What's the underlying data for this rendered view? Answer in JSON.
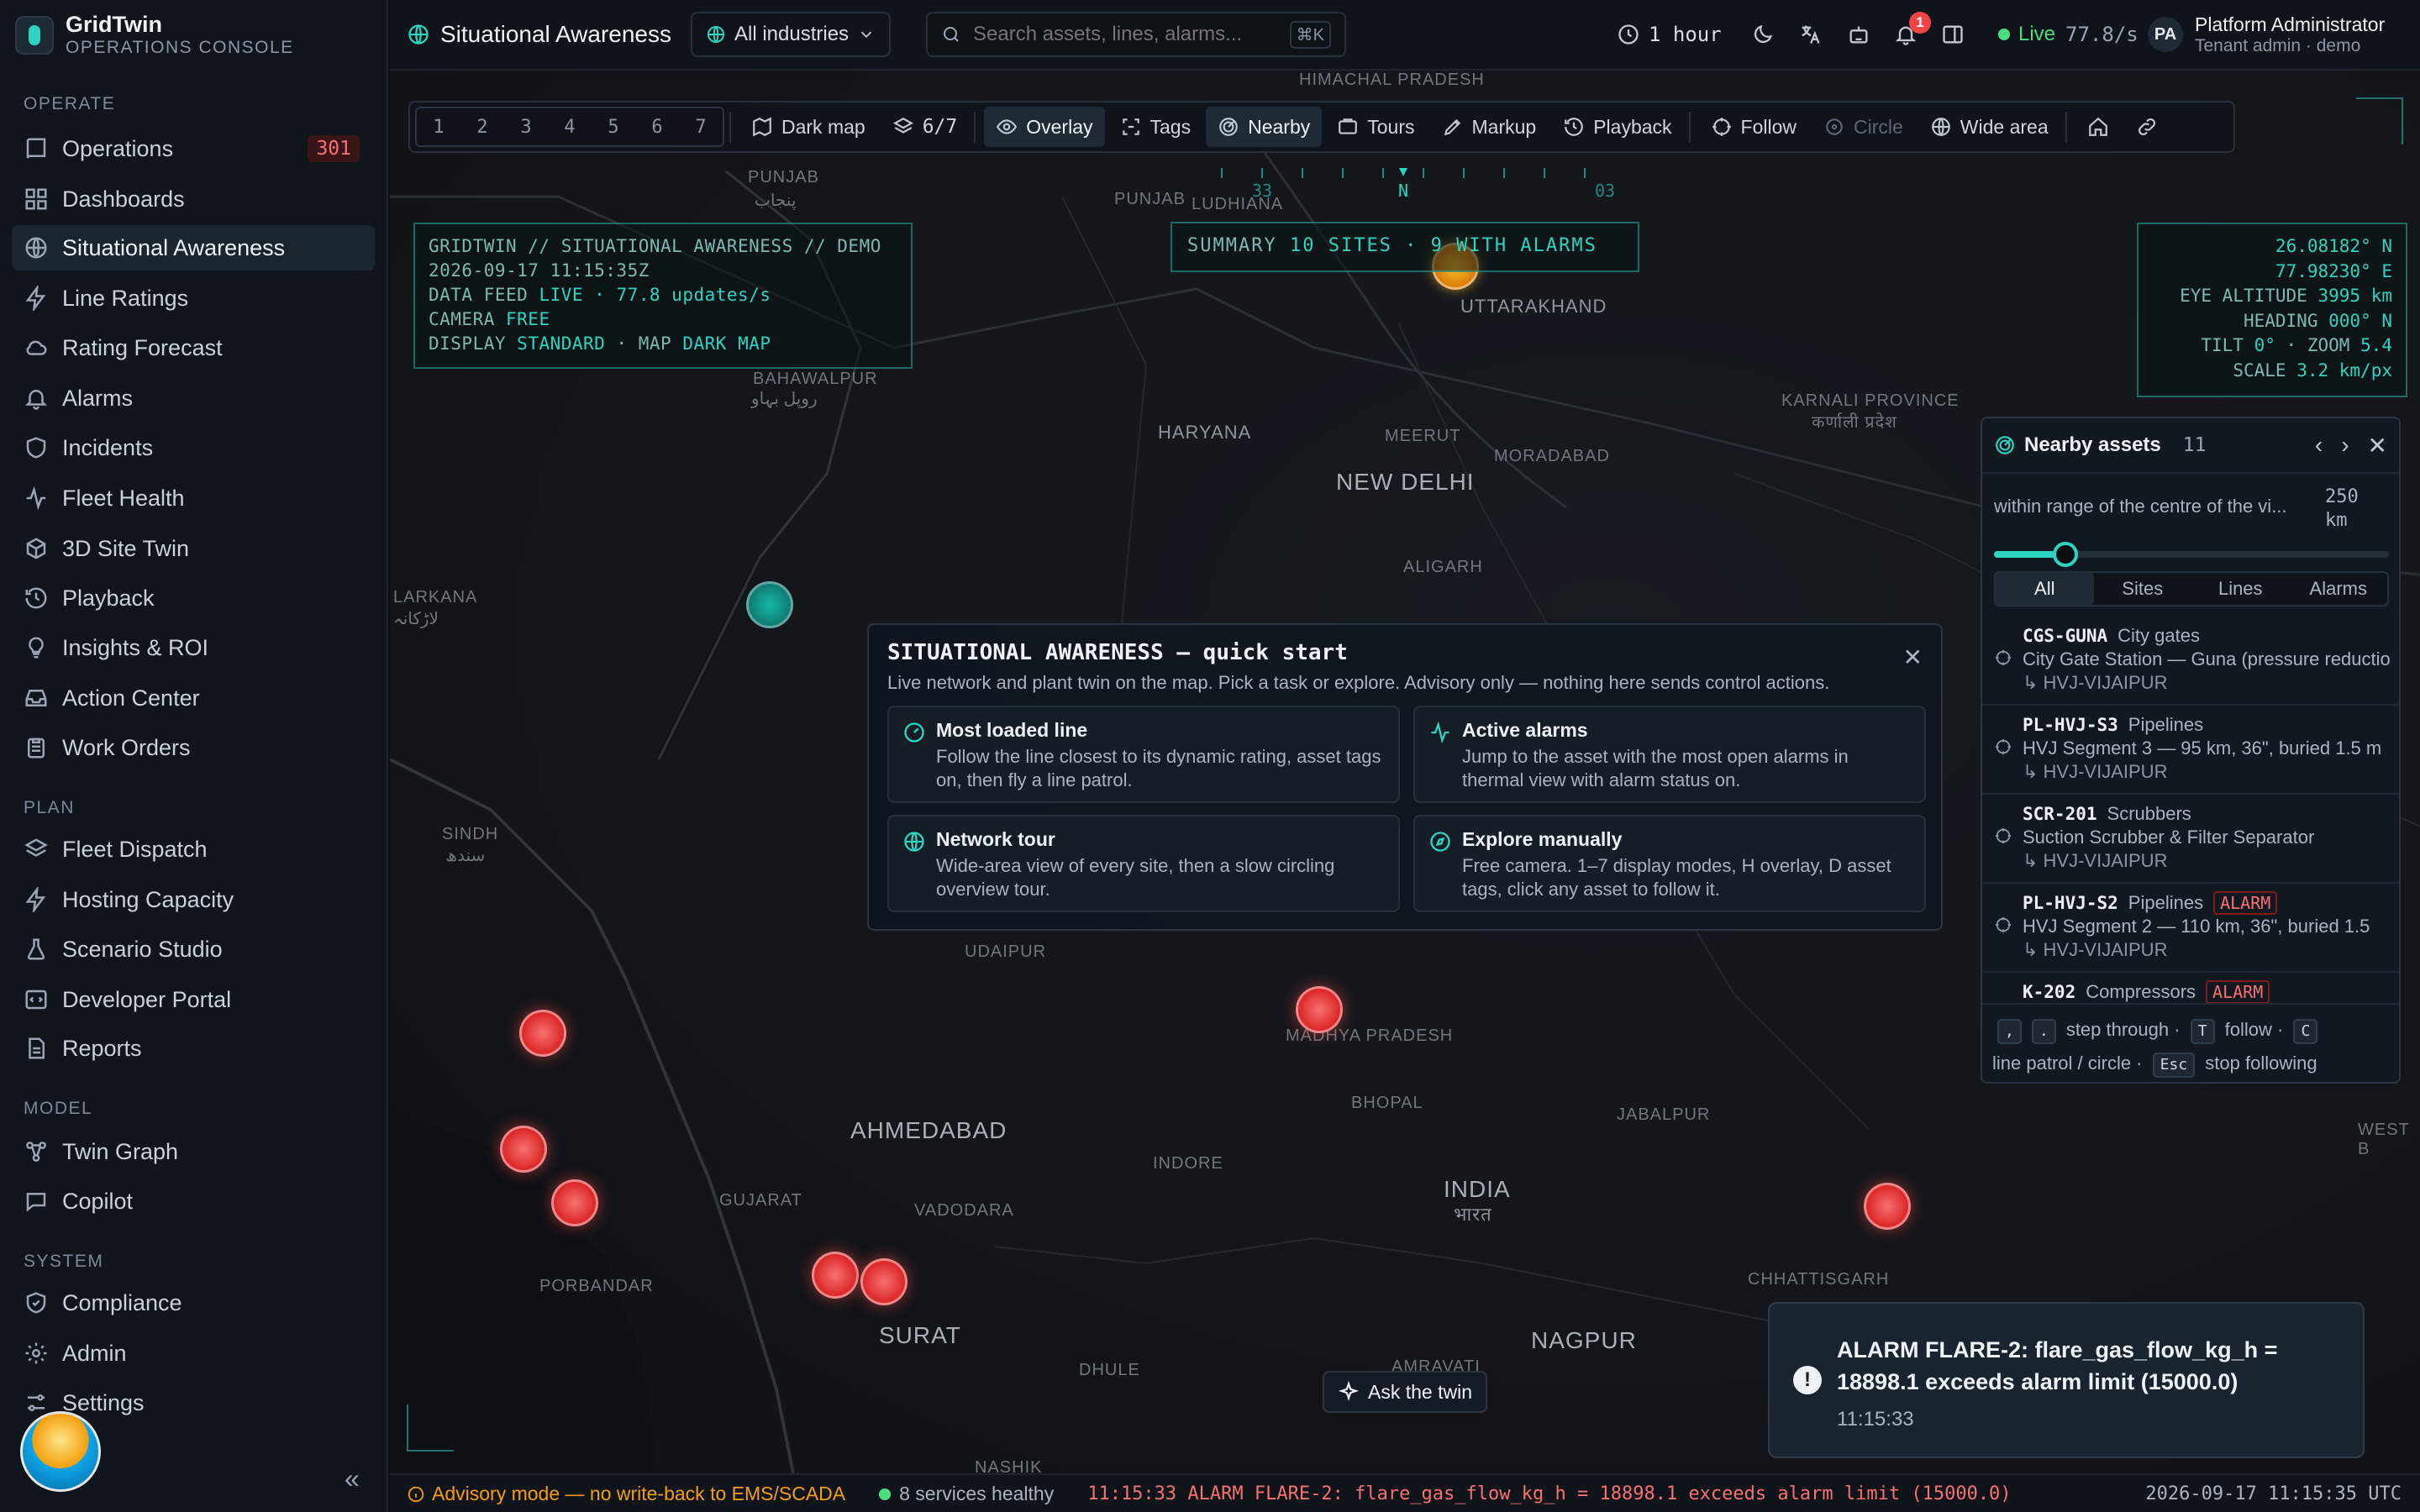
{
  "brand": {
    "name": "GridTwin",
    "subtitle": "OPERATIONS CONSOLE"
  },
  "sidebar": {
    "sections": [
      {
        "label": "OPERATE",
        "items": [
          {
            "label": "Operations",
            "icon": "book-icon",
            "badge": "301"
          },
          {
            "label": "Dashboards",
            "icon": "grid-icon"
          },
          {
            "label": "Situational Awareness",
            "icon": "globe-icon",
            "active": true
          },
          {
            "label": "Line Ratings",
            "icon": "bolt-icon"
          },
          {
            "label": "Rating Forecast",
            "icon": "cloud-icon"
          },
          {
            "label": "Alarms",
            "icon": "bell-icon"
          },
          {
            "label": "Incidents",
            "icon": "shield-icon"
          },
          {
            "label": "Fleet Health",
            "icon": "activity-icon"
          },
          {
            "label": "3D Site Twin",
            "icon": "cube-icon"
          },
          {
            "label": "Playback",
            "icon": "history-icon"
          },
          {
            "label": "Insights & ROI",
            "icon": "lightbulb-icon"
          },
          {
            "label": "Action Center",
            "icon": "inbox-icon"
          },
          {
            "label": "Work Orders",
            "icon": "clipboard-icon"
          }
        ]
      },
      {
        "label": "PLAN",
        "items": [
          {
            "label": "Fleet Dispatch",
            "icon": "layers-icon"
          },
          {
            "label": "Hosting Capacity",
            "icon": "bolt-icon"
          },
          {
            "label": "Scenario Studio",
            "icon": "flask-icon"
          },
          {
            "label": "Developer Portal",
            "icon": "code-icon"
          },
          {
            "label": "Reports",
            "icon": "document-icon"
          }
        ]
      },
      {
        "label": "MODEL",
        "items": [
          {
            "label": "Twin Graph",
            "icon": "network-icon"
          },
          {
            "label": "Copilot",
            "icon": "chat-icon"
          }
        ]
      },
      {
        "label": "SYSTEM",
        "items": [
          {
            "label": "Compliance",
            "icon": "badge-check-icon"
          },
          {
            "label": "Admin",
            "icon": "gear-icon"
          },
          {
            "label": "Settings",
            "icon": "sliders-icon"
          }
        ]
      }
    ],
    "collapse_glyph": "«"
  },
  "topbar": {
    "page_title": "Situational Awareness",
    "industry": "All industries",
    "search_placeholder": "Search assets, lines, alarms...",
    "search_shortcut": "⌘K",
    "time_range": "1 hour",
    "notifications": "1",
    "live_label": "Live",
    "live_rate": "77.8/s",
    "user_initials": "PA",
    "user_name": "Platform Administrator",
    "user_role": "Tenant admin · demo"
  },
  "toolbar": {
    "modes": [
      "1",
      "2",
      "3",
      "4",
      "5",
      "6",
      "7"
    ],
    "dark_map": "Dark map",
    "layers": "6/7",
    "overlay": "Overlay",
    "tags": "Tags",
    "nearby": "Nearby",
    "tours": "Tours",
    "markup": "Markup",
    "playback": "Playback",
    "follow": "Follow",
    "circle": "Circle",
    "wide_area": "Wide area"
  },
  "hud": {
    "header": "GRIDTWIN // SITUATIONAL AWARENESS // DEMO",
    "timestamp": "2026-09-17 11:15:35Z",
    "feed_label": "DATA FEED",
    "feed_value": "LIVE · 77.8 updates/s",
    "camera_label": "CAMERA",
    "camera_value": "FREE",
    "display_label": "DISPLAY",
    "display_value": "STANDARD",
    "map_label": "· MAP",
    "map_value": "DARK MAP",
    "summary_label": "SUMMARY",
    "summary_value": "10 SITES · 9 WITH ALARMS",
    "lat": "26.08182° N",
    "lon": "77.98230° E",
    "eye_label": "EYE ALTITUDE",
    "eye_value": "3995 km",
    "heading_label": "HEADING",
    "heading_value": "000° N",
    "tilt_label": "TILT",
    "tilt_value": "0°",
    "zoom_label": "· ZOOM",
    "zoom_value": "5.4",
    "scale_label": "SCALE",
    "scale_value": "3.2 km/px",
    "compass_n": "N",
    "compass_left": "33",
    "compass_right": "03"
  },
  "map_labels": {
    "punjab_pk": "PUNJAB",
    "punjab_pk_local": "پنجاب",
    "punjab_in": "PUNJAB",
    "ludhiana": "LUDHIANA",
    "bahawalpur": "BAHAWALPUR",
    "bahawalpur_local": "روپل بہاو",
    "uttarakhand": "UTTARAKHAND",
    "himachal": "HIMACHAL PRADESH",
    "haryana": "HARYANA",
    "meerut": "MEERUT",
    "moradabad": "MORADABAD",
    "new_delhi": "NEW DELHI",
    "aligarh": "ALIGARH",
    "kanpur_region": "KARNALI PROVINCE",
    "kanpur_region_local": "कर्णाली प्रदेश",
    "larkana": "LARKANA",
    "larkana_local": "لاڑکانہ",
    "sindh": "SINDH",
    "sindh_local": "سندھ",
    "udaipur": "UDAIPUR",
    "madhya_pradesh": "MADHYA PRADESH",
    "bhopal": "BHOPAL",
    "ahmedabad": "AHMEDABAD",
    "gujarat": "GUJARAT",
    "vadodara": "VADODARA",
    "indore": "INDORE",
    "jabalpur": "JABALPUR",
    "india": "INDIA",
    "india_local": "भारत",
    "porbandar": "PORBANDAR",
    "surat": "SURAT",
    "dhule": "DHULE",
    "amravati": "AMRAVATI",
    "nagpur": "NAGPUR",
    "chhattisgarh": "CHHATTISGARH",
    "nashik": "NASHIK",
    "west_b": "WEST B"
  },
  "quickstart": {
    "title": "SITUATIONAL AWARENESS — quick start",
    "description": "Live network and plant twin on the map. Pick a task or explore. Advisory only — nothing here sends control actions.",
    "cards": [
      {
        "title": "Most loaded line",
        "description": "Follow the line closest to its dynamic rating, asset tags on, then fly a line patrol.",
        "icon": "gauge-icon"
      },
      {
        "title": "Active alarms",
        "description": "Jump to the asset with the most open alarms in thermal view with alarm status on.",
        "icon": "activity-icon"
      },
      {
        "title": "Network tour",
        "description": "Wide-area view of every site, then a slow circling overview tour.",
        "icon": "globe-icon"
      },
      {
        "title": "Explore manually",
        "description": "Free camera. 1–7 display modes, H overlay, D asset tags, click any asset to follow it.",
        "icon": "compass-icon"
      }
    ]
  },
  "nearby": {
    "title": "Nearby assets",
    "count": "11",
    "range_text": "within range of the centre of the vi...",
    "range_value": "250",
    "range_unit": "km",
    "range_fraction": 0.18,
    "tabs": [
      "All",
      "Sites",
      "Lines",
      "Alarms"
    ],
    "rows": [
      {
        "id": "CGS-GUNA",
        "type": "City gates",
        "description": "City Gate Station — Guna (pressure reductio",
        "parent": "↳ HVJ-VIJAIPUR",
        "alarm": ""
      },
      {
        "id": "PL-HVJ-S3",
        "type": "Pipelines",
        "description": "HVJ Segment 3 — 95 km, 36\", buried 1.5 m",
        "parent": "↳ HVJ-VIJAIPUR",
        "alarm": ""
      },
      {
        "id": "SCR-201",
        "type": "Scrubbers",
        "description": "Suction Scrubber & Filter Separator",
        "parent": "↳ HVJ-VIJAIPUR",
        "alarm": ""
      },
      {
        "id": "PL-HVJ-S2",
        "type": "Pipelines",
        "description": "HVJ Segment 2 — 110 km, 36\", buried 1.5",
        "parent": "↳ HVJ-VIJAIPUR",
        "alarm": "ALARM"
      },
      {
        "id": "K-202",
        "type": "Compressors",
        "description": "",
        "parent": "",
        "alarm": "ALARM"
      }
    ],
    "keys": {
      "prev": ",",
      "next": ".",
      "step": "step through ·",
      "follow_key": "T",
      "follow": "follow ·",
      "circle_key": "C",
      "patrol": "line patrol / circle ·",
      "esc": "Esc",
      "stop": "stop following"
    }
  },
  "toast": {
    "message": "ALARM FLARE-2: flare_gas_flow_kg_h = 18898.1 exceeds alarm limit (15000.0)",
    "time": "11:15:33"
  },
  "ask": {
    "label": "Ask the twin"
  },
  "statusbar": {
    "advisory": "Advisory mode — no write-back to EMS/SCADA",
    "health": "8 services healthy",
    "alarm": "11:15:33 ALARM FLARE-2: flare_gas_flow_kg_h = 18898.1 exceeds alarm limit (15000.0)",
    "clock": "2026-09-17 11:15:35 UTC"
  },
  "colors": {
    "accent": "#2dd4bf",
    "alarm": "#ef4444",
    "warning": "#f59e0b",
    "live": "#4ade80"
  }
}
